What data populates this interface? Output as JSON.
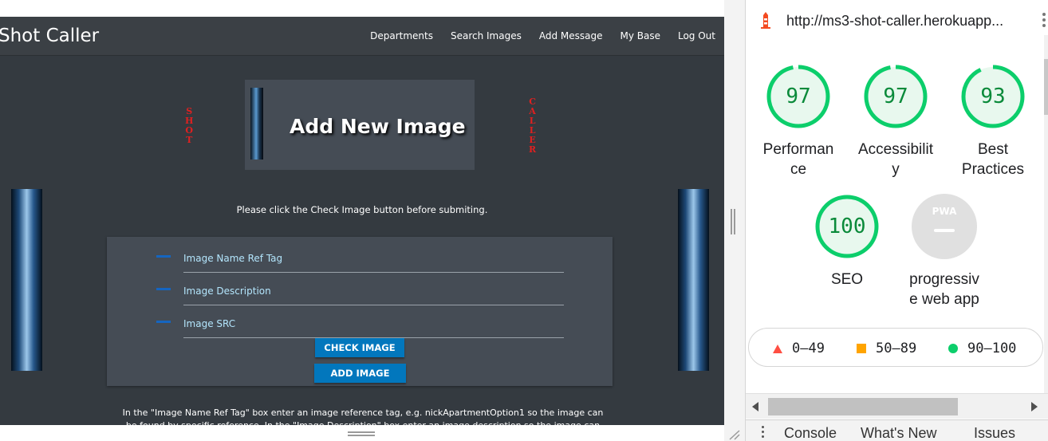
{
  "site": {
    "brand": "Shot Caller",
    "nav": [
      "Departments",
      "Search Images",
      "Add Message",
      "My Base",
      "Log Out"
    ],
    "vertical_left": [
      "S",
      "H",
      "O",
      "T"
    ],
    "vertical_right": [
      "C",
      "A",
      "L",
      "L",
      "E",
      "R"
    ],
    "page_title": "Add New Image",
    "notice": "Please click the Check Image button before submiting.",
    "fields": [
      {
        "label": "Image Name Ref Tag"
      },
      {
        "label": "Image Description"
      },
      {
        "label": "Image SRC"
      }
    ],
    "check_button": "CHECK IMAGE",
    "add_button": "ADD IMAGE",
    "help_text": "In the \"Image Name Ref Tag\" box enter an image reference tag, e.g. nickApartmentOption1 so the image can be found by specific reference. In the \"Image Description\" box enter an image description so the image can be found"
  },
  "devtools": {
    "url": "http://ms3-shot-caller.herokuapp...",
    "scores": [
      {
        "value": "97",
        "label": [
          "Performan",
          "ce"
        ],
        "ratio": 0.97
      },
      {
        "value": "97",
        "label": [
          "Accessibilit",
          "y"
        ],
        "ratio": 0.97
      },
      {
        "value": "93",
        "label": [
          "Best",
          "Practices"
        ],
        "ratio": 0.93
      },
      {
        "value": "100",
        "label": [
          "SEO"
        ],
        "ratio": 1.0
      }
    ],
    "pwa": {
      "badge": "PWA",
      "label": [
        "progressiv",
        "e web app"
      ]
    },
    "legend": [
      "0–49",
      "50–89",
      "90–100"
    ],
    "drawer_tabs": [
      "Console",
      "What's New",
      "Issues"
    ],
    "colors": {
      "pass": "#0cce6b",
      "pass_bg": "#e8f8ee",
      "average": "#ffa400",
      "fail": "#ff4e42"
    }
  }
}
